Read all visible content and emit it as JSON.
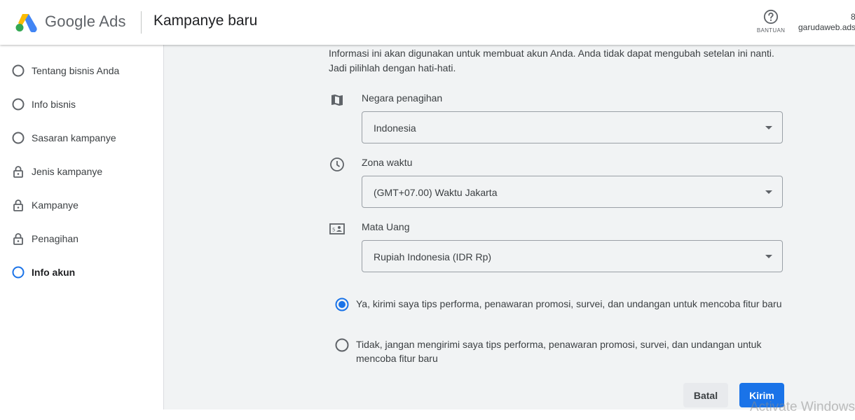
{
  "header": {
    "brand": "Google Ads",
    "page_title": "Kampanye baru",
    "help_label": "BANTUAN",
    "account_name": "garudaweb.ads",
    "account_top_char": "8"
  },
  "sidebar": {
    "items": [
      {
        "label": "Tentang bisnis Anda",
        "icon": "circle-outline-icon",
        "state": "incomplete"
      },
      {
        "label": "Info bisnis",
        "icon": "circle-outline-icon",
        "state": "incomplete"
      },
      {
        "label": "Sasaran kampanye",
        "icon": "circle-outline-icon",
        "state": "incomplete"
      },
      {
        "label": "Jenis kampanye",
        "icon": "lock-icon",
        "state": "locked"
      },
      {
        "label": "Kampanye",
        "icon": "lock-icon",
        "state": "locked"
      },
      {
        "label": "Penagihan",
        "icon": "lock-icon",
        "state": "locked"
      },
      {
        "label": "Info akun",
        "icon": "circle-outline-icon",
        "state": "active"
      }
    ]
  },
  "main": {
    "intro": "Informasi ini akan digunakan untuk membuat akun Anda. Anda tidak dapat mengubah setelan ini nanti. Jadi pilihlah dengan hati-hati.",
    "fields": [
      {
        "label": "Negara penagihan",
        "value": "Indonesia",
        "icon": "map-icon"
      },
      {
        "label": "Zona waktu",
        "value": "(GMT+07.00) Waktu Jakarta",
        "icon": "clock-icon"
      },
      {
        "label": "Mata Uang",
        "value": "Rupiah Indonesia (IDR Rp)",
        "icon": "currency-icon"
      }
    ],
    "radios": [
      {
        "label": "Ya, kirimi saya tips performa, penawaran promosi, survei, dan undangan untuk mencoba fitur baru",
        "checked": true
      },
      {
        "label": "Tidak, jangan mengirimi saya tips performa, penawaran promosi, survei, dan undangan untuk mencoba fitur baru",
        "checked": false
      }
    ],
    "cancel_label": "Batal",
    "submit_label": "Kirim"
  },
  "colors": {
    "accent": "#1a73e8",
    "background": "#f1f3f4"
  },
  "overlay": {
    "watermark": "Activate Windows"
  }
}
